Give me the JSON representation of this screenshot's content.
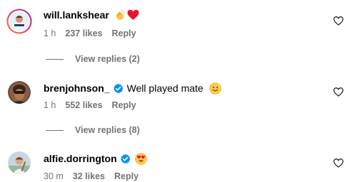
{
  "comments": [
    {
      "username": "will.lankshear",
      "verified": false,
      "text": "",
      "emojis": [
        "clapping-hands",
        "red-heart"
      ],
      "time": "1 h",
      "likes": "237 likes",
      "reply_label": "Reply",
      "view_replies": "View replies (2)"
    },
    {
      "username": "brenjohnson_",
      "verified": true,
      "text": "Well played mate",
      "emojis": [
        "slightly-smiling-face"
      ],
      "time": "1 h",
      "likes": "552 likes",
      "reply_label": "Reply",
      "view_replies": "View replies (8)"
    },
    {
      "username": "alfie.dorrington",
      "verified": true,
      "text": "",
      "emojis": [
        "heart-eyes-face"
      ],
      "time": "30 m",
      "likes": "32 likes",
      "reply_label": "Reply"
    }
  ],
  "colors": {
    "text": "#000000",
    "secondary": "#737373",
    "verified": "#0095F6",
    "story_ring_start": "#F58529",
    "story_ring_end": "#DD2A7B"
  }
}
